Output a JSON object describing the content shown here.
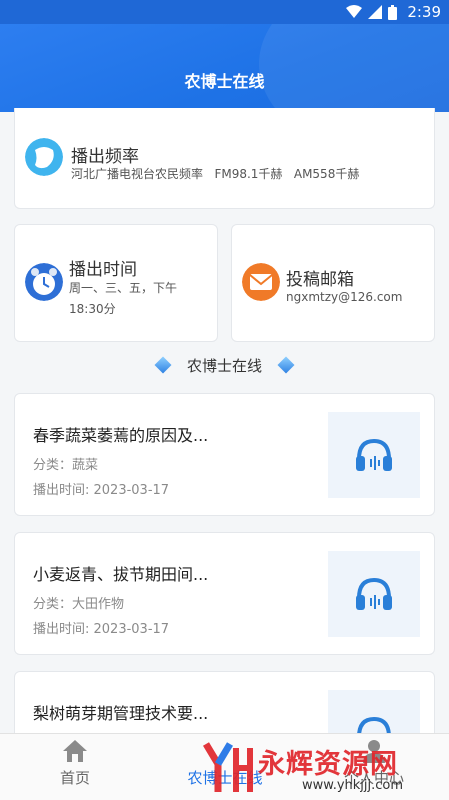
{
  "status_bar": {
    "time": "2:39"
  },
  "header": {
    "title": "农博士在线"
  },
  "frequency": {
    "title": "播出频率",
    "subtitle": "河北广播电视台农民频率   FM98.1千赫   AM558千赫",
    "icon": "radio-wave-icon"
  },
  "broadcast_time": {
    "title": "播出时间",
    "detail": "周一、三、五，下午18:30分",
    "icon": "alarm-clock-icon"
  },
  "mailbox": {
    "title": "投稿邮箱",
    "email": "ngxmtzy@126.com",
    "icon": "envelope-icon"
  },
  "section": {
    "title": "农博士在线"
  },
  "list": [
    {
      "title": "春季蔬菜萎蔫的原因及...",
      "category": "分类：蔬菜",
      "date": "播出时间: 2023-03-17"
    },
    {
      "title": "小麦返青、拔节期田间...",
      "category": "分类：大田作物",
      "date": "播出时间: 2023-03-17"
    },
    {
      "title": "梨树萌芽期管理技术要..."
    }
  ],
  "nav": {
    "items": [
      {
        "label": "首页",
        "icon": "home-icon"
      },
      {
        "label": "农博士在线",
        "icon": ""
      },
      {
        "label": "个人中心",
        "icon": "user-icon"
      }
    ]
  },
  "watermark": {
    "text": "永辉资源网",
    "url": "www.yhkjjj.com"
  },
  "colors": {
    "brand_blue": "#1e72e6",
    "accent_orange": "#f07a28",
    "icon_blue": "#2a7fd8"
  }
}
